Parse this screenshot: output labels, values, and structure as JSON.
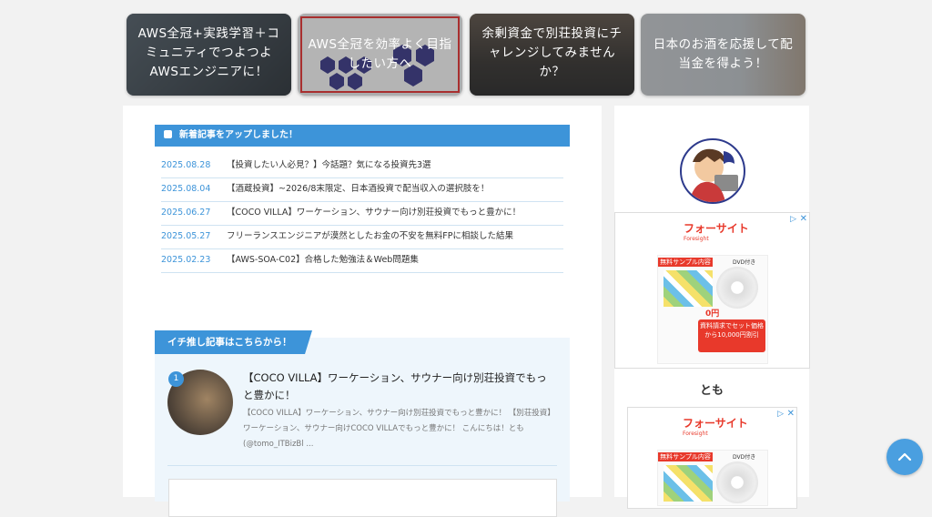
{
  "cards": [
    {
      "title": "AWS全冠+実践学習＋コミュニティでつよつよAWSエンジニアに！"
    },
    {
      "title": "AWS全冠を効率よく目指したい方へ"
    },
    {
      "title": "余剰資金で別荘投資にチャレンジしてみませんか？"
    },
    {
      "title": "日本のお酒を応援して配当金を得よう！"
    }
  ],
  "news": {
    "heading": "新着記事をアップしました！",
    "items": [
      {
        "date": "2025.08.28",
        "title": "【投資したい人必見？】今話題？気になる投資先3選"
      },
      {
        "date": "2025.08.04",
        "title": "【酒蔵投資】~2026/8末限定、日本酒投資で配当収入の選択肢を！"
      },
      {
        "date": "2025.06.27",
        "title": "【COCO VILLA】ワーケーション、サウナー向け別荘投資でもっと豊かに！"
      },
      {
        "date": "2025.05.27",
        "title": "フリーランスエンジニアが漠然としたお金の不安を無料FPに相談した結果"
      },
      {
        "date": "2025.02.23",
        "title": "【AWS-SOA-C02】合格した勉強法＆Web問題集"
      }
    ]
  },
  "pickup": {
    "heading": "イチ推し記事はこちらから！",
    "rank": "1",
    "title": "【COCO VILLA】ワーケーション、サウナー向け別荘投資でもっと豊かに！",
    "excerpt": "【COCO VILLA】ワーケーション、サウナー向け別荘投資でもっと豊かに！ 【別荘投資】ワーケーション、サウナー向けCOCO VILLAでもっと豊かに！ こんにちは！とも(@tomo_ITBizBl ..."
  },
  "sidebar": {
    "author_name": "とも",
    "ad_brand": "フォーサイト",
    "ad_brand_sub": "Foresight",
    "ad_sample": "無料サンプル内容",
    "ad_dvd": "DVD付き",
    "ad_discount": "資料請求でセット価格から10,000円割引",
    "ad_price": "0円"
  },
  "colors": {
    "accent": "#3d94d9",
    "brand_red": "#e8392b"
  }
}
